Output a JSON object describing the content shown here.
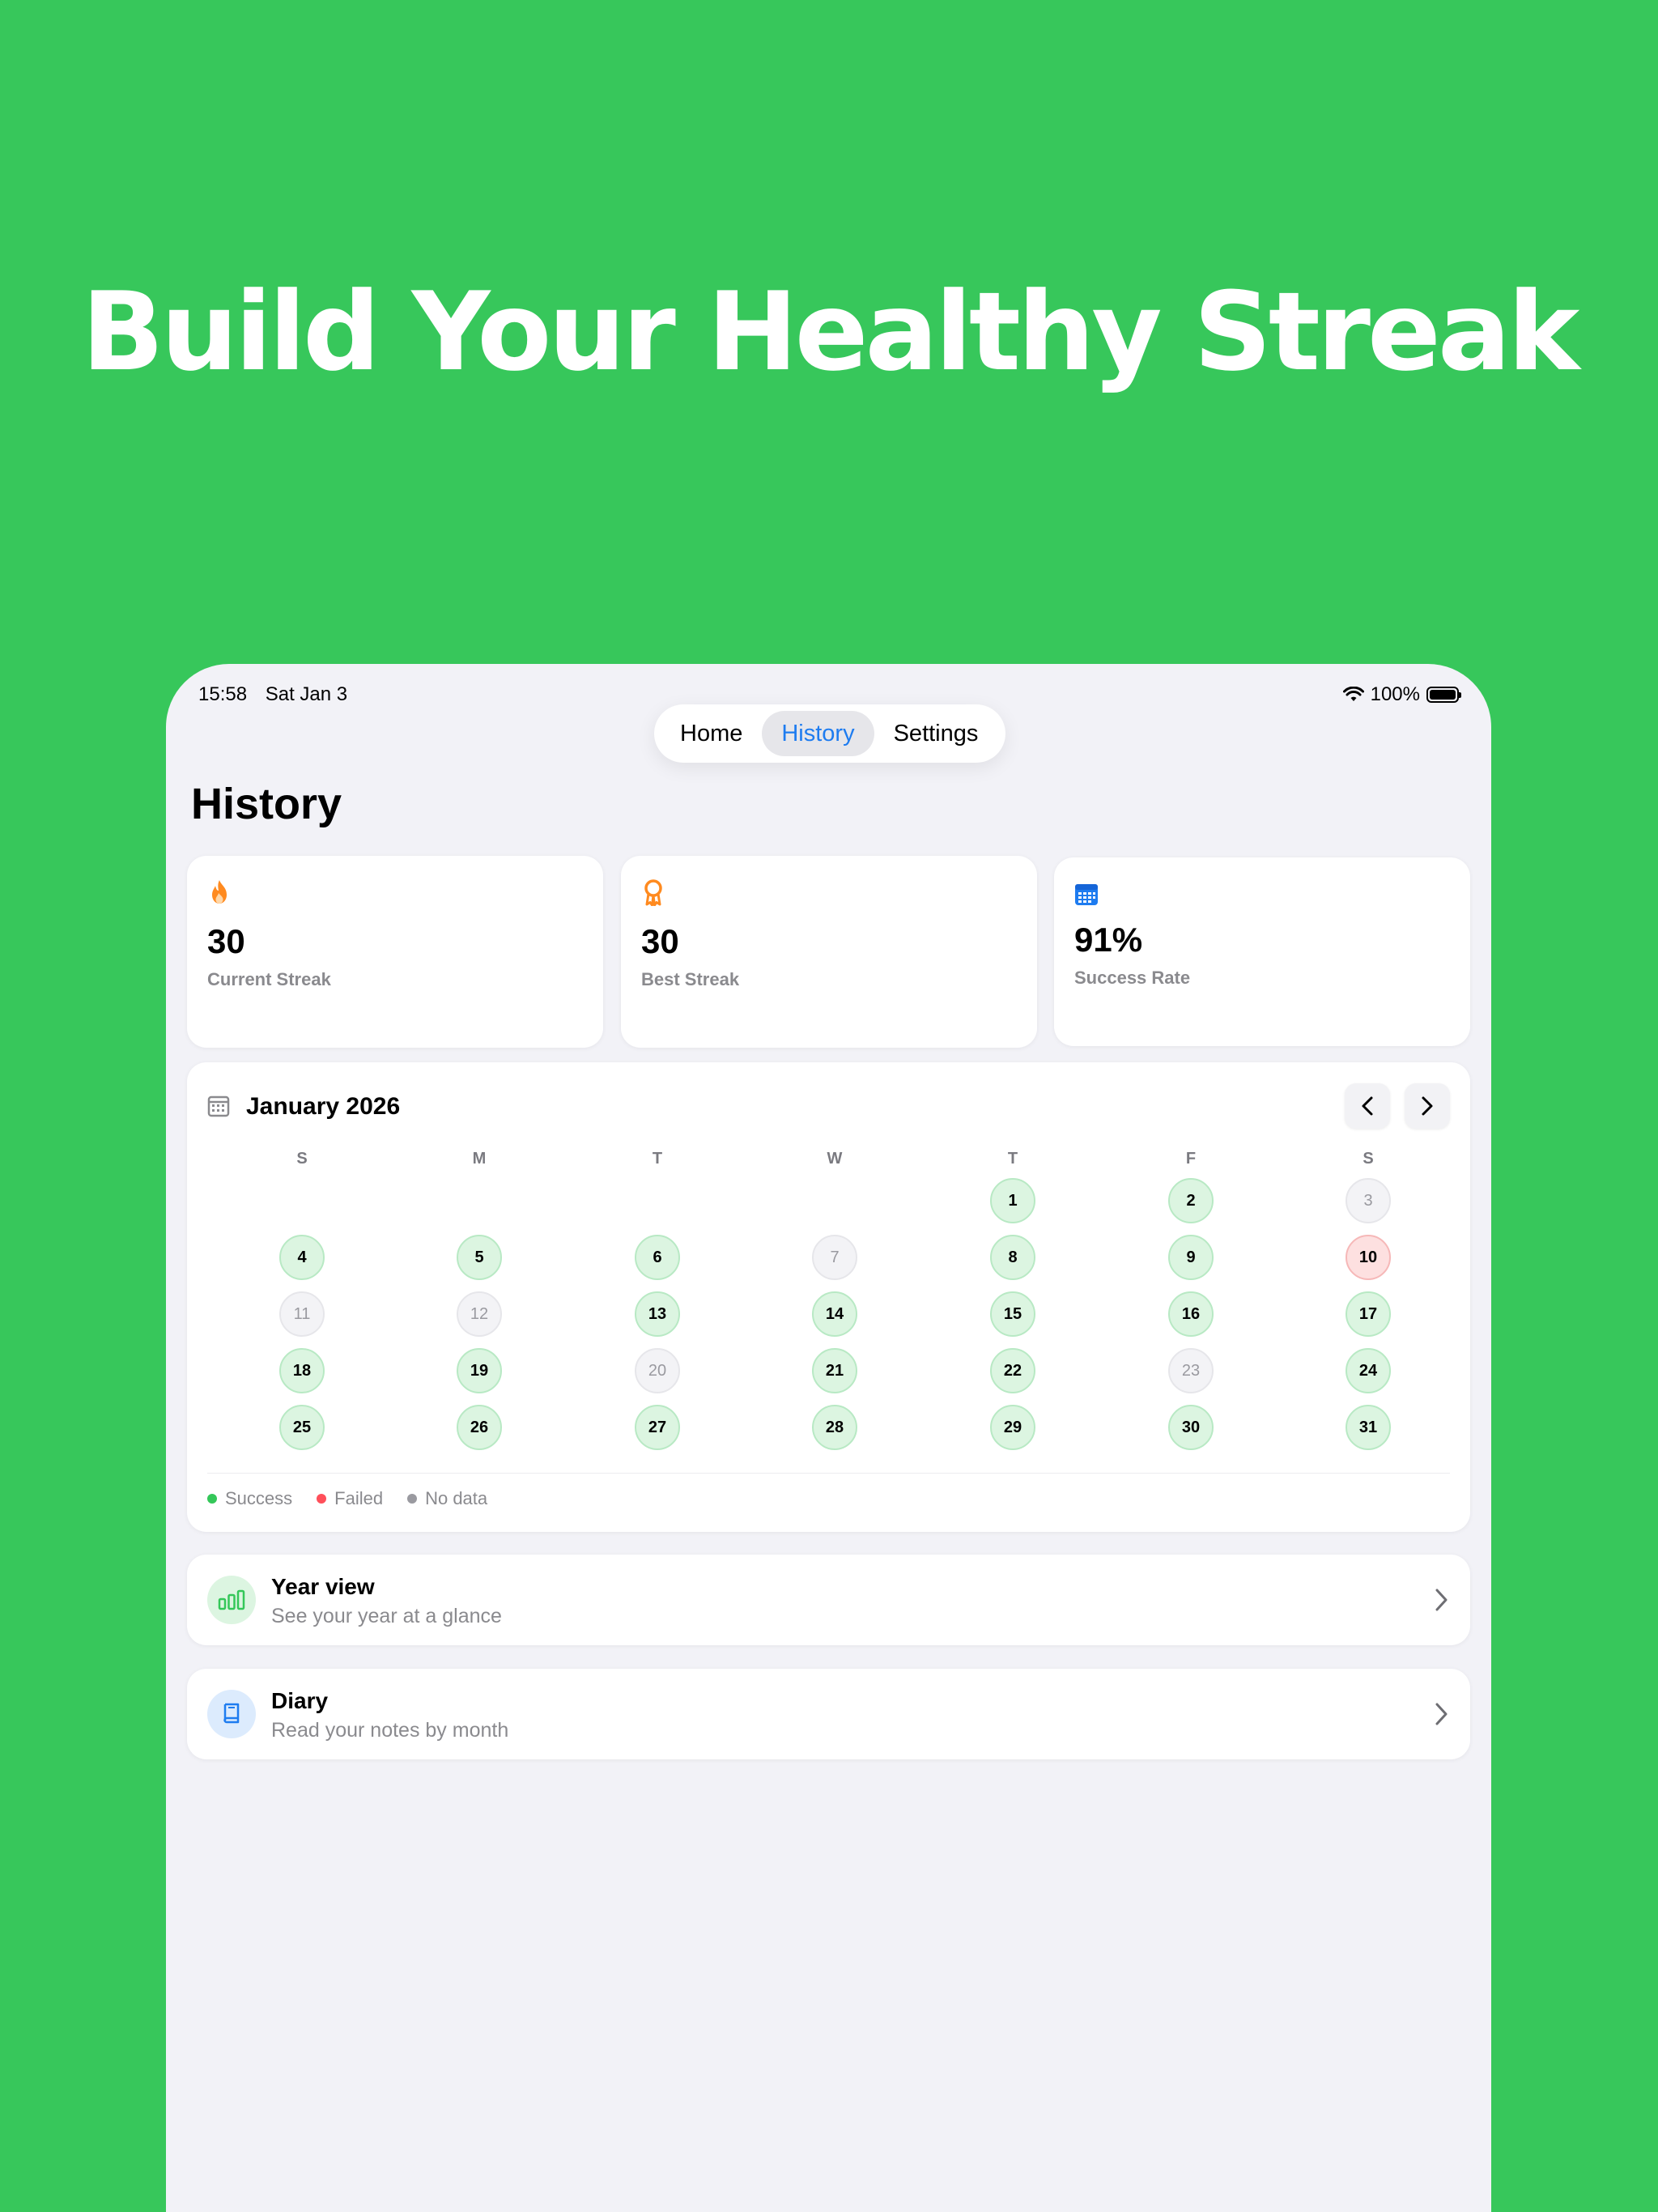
{
  "hero": {
    "title": "Build Your Healthy Streak"
  },
  "status_bar": {
    "time": "15:58",
    "date": "Sat Jan 3",
    "battery": "100%"
  },
  "tabs": [
    {
      "label": "Home",
      "active": false
    },
    {
      "label": "History",
      "active": true
    },
    {
      "label": "Settings",
      "active": false
    }
  ],
  "page": {
    "title": "History"
  },
  "stats": [
    {
      "icon": "flame-icon",
      "value": "30",
      "label": "Current Streak"
    },
    {
      "icon": "award-ribbon-icon",
      "value": "30",
      "label": "Best Streak"
    },
    {
      "icon": "calendar-icon",
      "value": "91%",
      "label": "Success Rate"
    }
  ],
  "calendar": {
    "month": "January 2026",
    "weekdays": [
      "S",
      "M",
      "T",
      "W",
      "T",
      "F",
      "S"
    ],
    "first_weekday_index": 4,
    "days": [
      {
        "n": "1",
        "s": "success"
      },
      {
        "n": "2",
        "s": "success"
      },
      {
        "n": "3",
        "s": "nodata"
      },
      {
        "n": "4",
        "s": "success"
      },
      {
        "n": "5",
        "s": "success"
      },
      {
        "n": "6",
        "s": "success"
      },
      {
        "n": "7",
        "s": "nodata"
      },
      {
        "n": "8",
        "s": "success"
      },
      {
        "n": "9",
        "s": "success"
      },
      {
        "n": "10",
        "s": "failed"
      },
      {
        "n": "11",
        "s": "nodata"
      },
      {
        "n": "12",
        "s": "nodata"
      },
      {
        "n": "13",
        "s": "success"
      },
      {
        "n": "14",
        "s": "success"
      },
      {
        "n": "15",
        "s": "success"
      },
      {
        "n": "16",
        "s": "success"
      },
      {
        "n": "17",
        "s": "success"
      },
      {
        "n": "18",
        "s": "success"
      },
      {
        "n": "19",
        "s": "success"
      },
      {
        "n": "20",
        "s": "nodata"
      },
      {
        "n": "21",
        "s": "success"
      },
      {
        "n": "22",
        "s": "success"
      },
      {
        "n": "23",
        "s": "nodata"
      },
      {
        "n": "24",
        "s": "success"
      },
      {
        "n": "25",
        "s": "success"
      },
      {
        "n": "26",
        "s": "success"
      },
      {
        "n": "27",
        "s": "success"
      },
      {
        "n": "28",
        "s": "success"
      },
      {
        "n": "29",
        "s": "success"
      },
      {
        "n": "30",
        "s": "success"
      },
      {
        "n": "31",
        "s": "success"
      }
    ],
    "legend": [
      {
        "label": "Success",
        "color": "#34c759"
      },
      {
        "label": "Failed",
        "color": "#ff4f5a"
      },
      {
        "label": "No data",
        "color": "#9a9aa0"
      }
    ]
  },
  "rows": [
    {
      "icon": "bar-chart-icon",
      "title": "Year view",
      "subtitle": "See your year at a glance"
    },
    {
      "icon": "book-icon",
      "title": "Diary",
      "subtitle": "Read your notes by month"
    }
  ],
  "colors": {
    "brand_green": "#37c75b",
    "accent_blue": "#1e7cf0",
    "flame_orange": "#ff8a1f"
  }
}
